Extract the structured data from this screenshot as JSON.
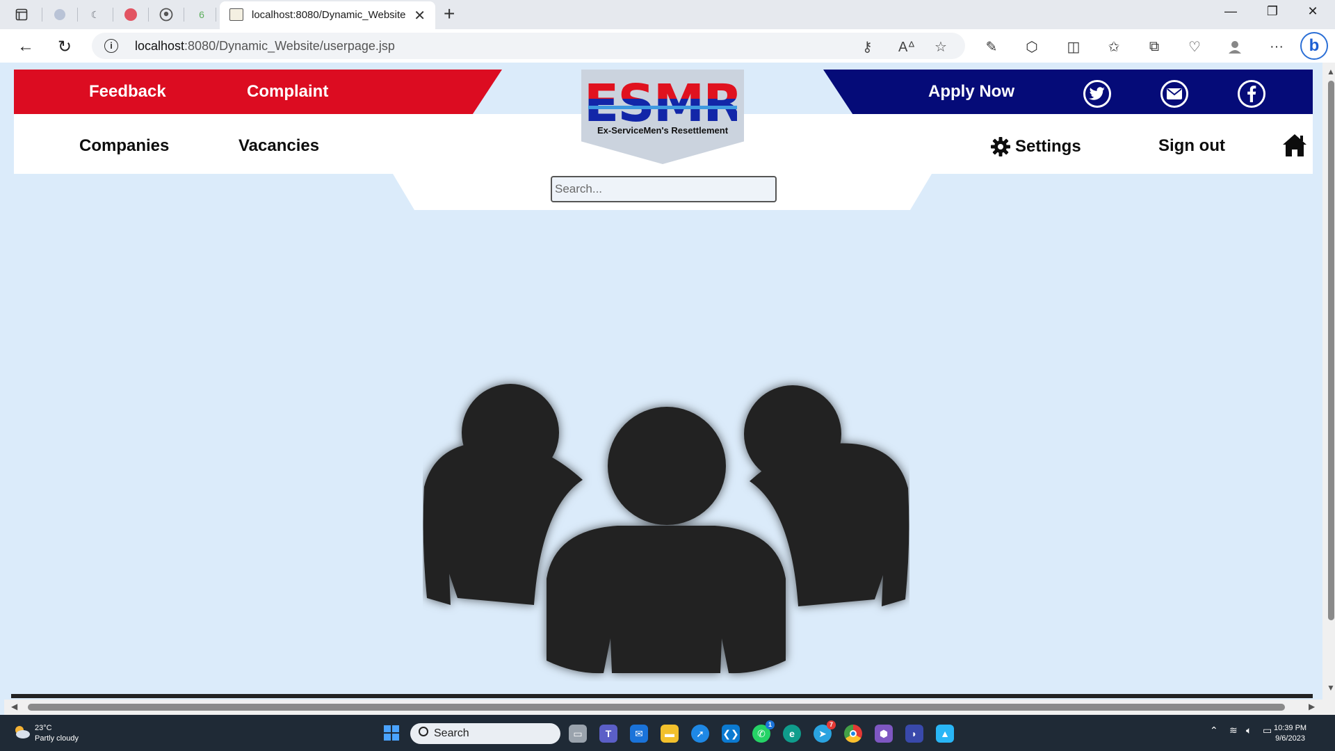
{
  "browser": {
    "active_tab_title": "localhost:8080/Dynamic_Website",
    "url_host": "localhost",
    "url_rest": ":8080/Dynamic_Website/userpage.jsp"
  },
  "site": {
    "logo_text": "ESMR",
    "logo_tagline": "Ex-ServiceMen's Resettlement",
    "top_red_links": [
      "Feedback",
      "Complaint"
    ],
    "apply_label": "Apply Now",
    "nav_left": [
      "Companies",
      "Vacancies"
    ],
    "settings_label": "Settings",
    "signout_label": "Sign out",
    "search_placeholder": "Search...",
    "colors": {
      "red": "#dc0c21",
      "navy": "#050b78",
      "page_bg": "#dbebfa",
      "logo_red": "#e0121f",
      "logo_blue": "#1226a8"
    },
    "hero_icon": "users-group-icon"
  },
  "taskbar": {
    "weather_temp": "23°C",
    "weather_desc": "Partly cloudy",
    "search_label": "Search",
    "time": "10:39 PM",
    "date": "9/6/2023",
    "whatsapp_badge": "1",
    "telegram_badge": "7"
  }
}
